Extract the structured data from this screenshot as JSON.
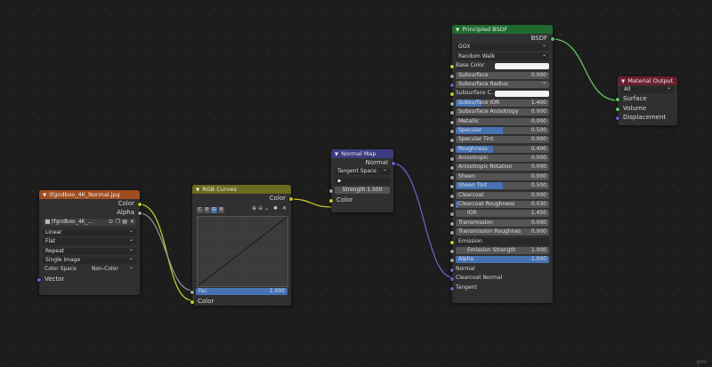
{
  "nodes": {
    "image_texture": {
      "title": "tfgndbxo_4K_Normal.jpg",
      "outputs": [
        "Color",
        "Alpha"
      ],
      "image_name": "tfgndbxo_4K_...",
      "interpolation": "Linear",
      "projection": "Flat",
      "extension": "Repeat",
      "source": "Single Image",
      "color_space_label": "Color Space",
      "color_space_value": "Non-Color",
      "vector_label": "Vector",
      "header_color": "#a04d1f"
    },
    "rgb_curves": {
      "title": "RGB Curves",
      "output": "Color",
      "channels": [
        "C",
        "R",
        "G",
        "B"
      ],
      "active_channel": "G",
      "fac_label": "Fac",
      "fac_value": "1.000",
      "input": "Color",
      "header_color": "#6b6b1f"
    },
    "normal_map": {
      "title": "Normal Map",
      "output": "Normal",
      "space": "Tangent Space",
      "strength_label": "Strength",
      "strength_value": "1.500",
      "input": "Color",
      "header_color": "#3c3c82"
    },
    "principled": {
      "title": "Principled BSDF",
      "output": "BSDF",
      "distribution": "GGX",
      "subsurface_method": "Random Walk",
      "header_color": "#1f6b2e",
      "rows": [
        {
          "label": "Base Color",
          "kind": "color"
        },
        {
          "label": "Subsurface",
          "value": "0.000",
          "fill": 0
        },
        {
          "label": "Subsurface Radius",
          "kind": "dropdown"
        },
        {
          "label": "Subsurface C...",
          "kind": "color"
        },
        {
          "label": "Subsurface IOR",
          "value": "1.400",
          "fill": 0.28
        },
        {
          "label": "Subsurface Anisotropy",
          "value": "0.000",
          "fill": 0
        },
        {
          "label": "Metallic",
          "value": "0.000",
          "fill": 0
        },
        {
          "label": "Specular",
          "value": "0.500",
          "fill": 0.5
        },
        {
          "label": "Specular Tint",
          "value": "0.000",
          "fill": 0
        },
        {
          "label": "Roughness",
          "value": "0.400",
          "fill": 0.4
        },
        {
          "label": "Anisotropic",
          "value": "0.000",
          "fill": 0
        },
        {
          "label": "Anisotropic Rotation",
          "value": "0.000",
          "fill": 0
        },
        {
          "label": "Sheen",
          "value": "0.000",
          "fill": 0
        },
        {
          "label": "Sheen Tint",
          "value": "0.500",
          "fill": 0.5
        },
        {
          "label": "Clearcoat",
          "value": "0.000",
          "fill": 0
        },
        {
          "label": "Clearcoat Roughness",
          "value": "0.030",
          "fill": 0.03
        },
        {
          "label": "IOR",
          "value": "1.450",
          "fill": 0,
          "center": true
        },
        {
          "label": "Transmission",
          "value": "0.000",
          "fill": 0
        },
        {
          "label": "Transmission Roughnes",
          "value": "0.000",
          "fill": 0
        },
        {
          "label": "Emission",
          "kind": "dark"
        },
        {
          "label": "Emission Strength",
          "value": "1.000",
          "fill": 0,
          "center": true
        },
        {
          "label": "Alpha",
          "value": "1.000",
          "fill": 1
        },
        {
          "label": "Normal",
          "kind": "plain"
        },
        {
          "label": "Clearcoat Normal",
          "kind": "plain"
        },
        {
          "label": "Tangent",
          "kind": "plain"
        }
      ]
    },
    "material_output": {
      "title": "Material Output",
      "target": "All",
      "inputs": [
        "Surface",
        "Volume",
        "Displacement"
      ],
      "header_color": "#6b1f2e"
    }
  },
  "watermark": "gml"
}
